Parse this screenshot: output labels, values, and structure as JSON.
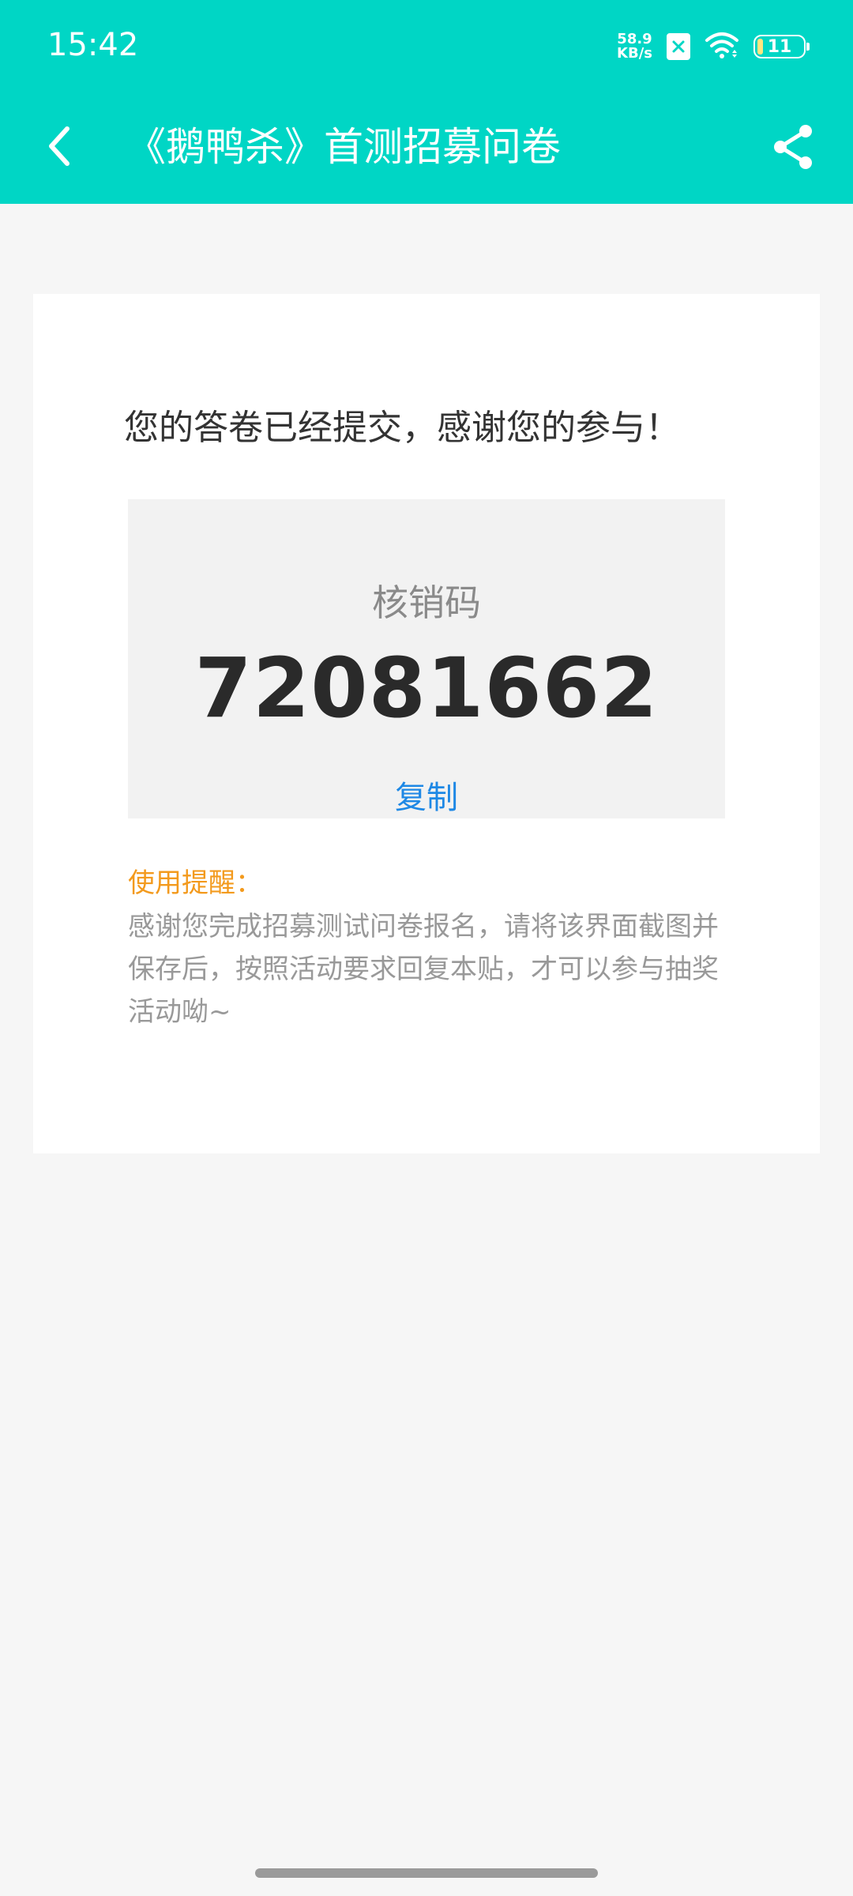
{
  "status_bar": {
    "time": "15:42",
    "net_speed_value": "58.9",
    "net_speed_unit": "KB/s",
    "battery_level": "11",
    "icons": [
      "sim-disabled-icon",
      "wifi-icon",
      "battery-icon"
    ]
  },
  "header": {
    "title": "《鹅鸭杀》首测招募问卷",
    "back_icon": "back-arrow-icon",
    "share_icon": "share-icon",
    "bg_color": "#00d6c5"
  },
  "card": {
    "thanks_text": "您的答卷已经提交，感谢您的参与！",
    "code_label": "核销码",
    "code_value": "72081662",
    "copy_label": "复制",
    "notice_title": "使用提醒：",
    "notice_body": "感谢您完成招募测试问卷报名，请将该界面截图并保存后，按照活动要求回复本贴，才可以参与抽奖活动呦~"
  }
}
